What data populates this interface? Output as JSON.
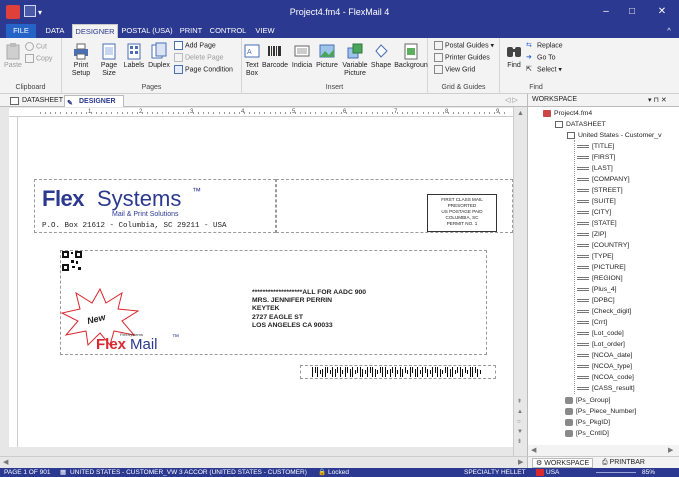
{
  "window": {
    "title": "Project4.fm4 - FlexMail 4",
    "minimize": "–",
    "maximize": "□",
    "close": "✕"
  },
  "menu": {
    "tabs": [
      "FILE",
      "DATA",
      "DESIGNER",
      "POSTAL (USA)",
      "PRINT",
      "CONTROL",
      "VIEW"
    ],
    "active": "DESIGNER",
    "collapse": "^"
  },
  "ribbon": {
    "clipboard": {
      "cut": "Cut",
      "copy": "Copy",
      "paste": "Paste",
      "label": "Clipboard"
    },
    "pages": {
      "print_setup": "Print Setup",
      "page_size": "Page Size",
      "labels": "Labels",
      "duplex": "Duplex",
      "add_page": "Add Page",
      "delete_page": "Delete Page",
      "page_condition": "Page Condition",
      "label": "Pages"
    },
    "insert": {
      "text_box": "Text Box",
      "barcode": "Barcode",
      "indicia": "Indicia",
      "picture": "Picture",
      "variable_picture": "Variable Picture",
      "shape": "Shape",
      "background": "Backgroun",
      "label": "Insert"
    },
    "grid": {
      "postal_guides": "Postal Guides",
      "printer_guides": "Printer Guides",
      "view_grid": "View Grid",
      "label": "Grid & Guides"
    },
    "find": {
      "find": "Find",
      "replace": "Replace",
      "goto": "Go To",
      "select": "Select",
      "label": "Find"
    }
  },
  "doctabs": {
    "datasheet": "DATASHEET",
    "designer": "DESIGNER",
    "nav": "◁ ▷"
  },
  "workspace": {
    "title": "WORKSPACE",
    "pin": "▾ ⊓ ✕",
    "project": "Project4.fm4",
    "datasheet": "DATASHEET",
    "table": "United States - Customer_v",
    "fields": [
      "[TITLE]",
      "[FIRST]",
      "[LAST]",
      "[COMPANY]",
      "[STREET]",
      "[SUITE]",
      "[CITY]",
      "[STATE]",
      "[ZIP]",
      "[COUNTRY]",
      "[TYPE]",
      "[PICTURE]",
      "[REGION]",
      "[Plus_4]",
      "[DPBC]",
      "[Check_digit]",
      "[Crrt]",
      "[Lot_code]",
      "[Lot_order]",
      "[NCOA_date]",
      "[NCOA_type]",
      "[NCOA_code]",
      "[CASS_result]"
    ],
    "groups": [
      "[Ps_Group]",
      "[Ps_Piece_Number]",
      "[Ps_PkgID]",
      "[Ps_CntID]"
    ],
    "bottom_tabs": [
      "WORKSPACE",
      "PRINTBAR"
    ]
  },
  "envelope": {
    "logo_flex": "Flex",
    "logo_systems": "Systems",
    "tm": "™",
    "tagline": "Mail & Print Solutions",
    "return_address": "P.O. Box 21612 - Columbia, SC 29211 - USA",
    "indicia": [
      "FIRST CLASS MAIL",
      "PRESORTED",
      "US POSTAGE PAID",
      "COLUMBIA, SC",
      "PERMIT NO. 1"
    ],
    "address": [
      "*******************ALL FOR AADC 900",
      "MRS. JENNIFER PERRIN",
      "KEYTEK",
      "2727 EAGLE ST",
      "LOS ANGELES CA 90033"
    ],
    "badge": "New",
    "product_small": "FlexSystems",
    "product_flex": "Flex",
    "product_mail": "Mail"
  },
  "ruler_marks": [
    "1",
    "2",
    "3",
    "4",
    "5",
    "6",
    "7",
    "8",
    "9"
  ],
  "status": {
    "page": "PAGE 1 OF 901",
    "table": "UNITED STATES - CUSTOMER_VW 3 ACCOR (UNITED STATES - CUSTOMER)",
    "lock": "Locked",
    "hint": "SPECIALTY HELLET",
    "country": "USA",
    "zoom": "85%"
  },
  "colors": {
    "brand": "#2b3990",
    "accent": "#d9282f",
    "logo_blue": "#2b3990"
  }
}
